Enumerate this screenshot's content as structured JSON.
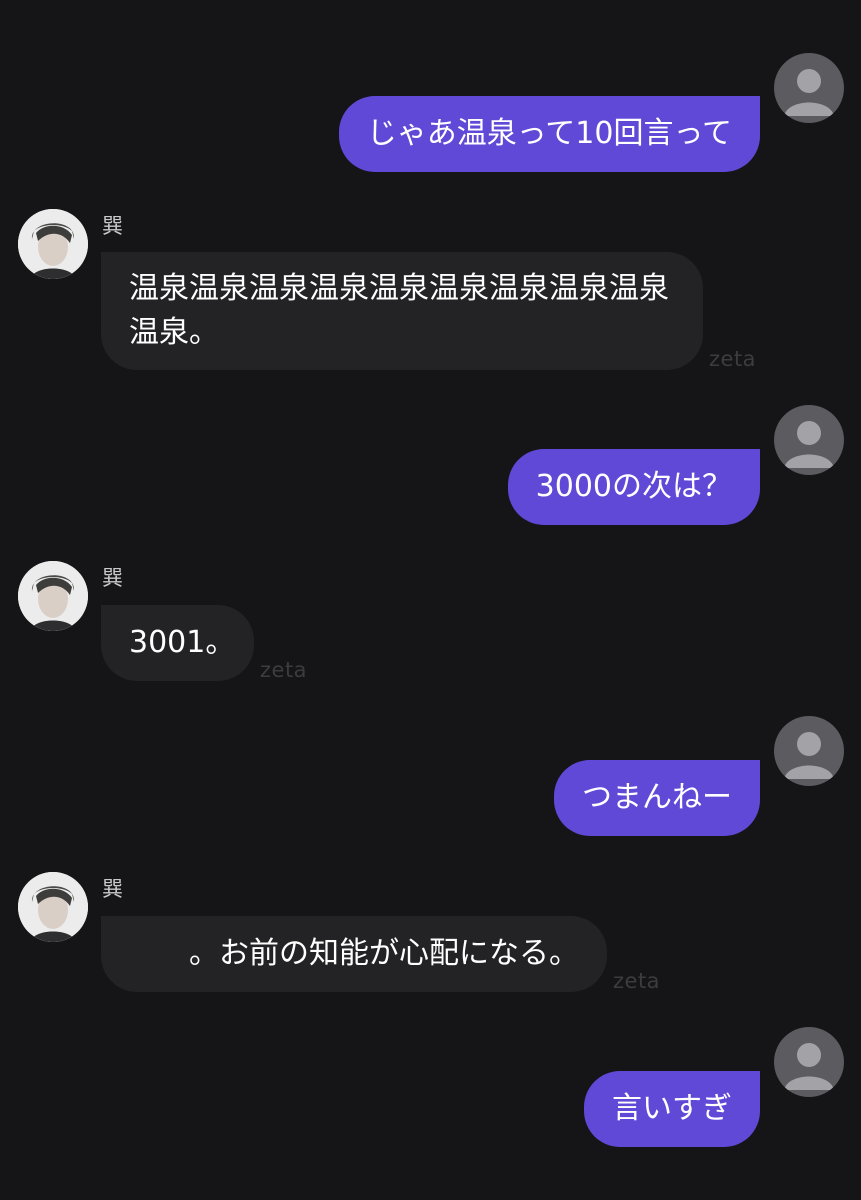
{
  "bot": {
    "name": "巽"
  },
  "watermark": "zeta",
  "messages": [
    {
      "role": "user",
      "text": "じゃあ温泉って10回言って"
    },
    {
      "role": "bot",
      "text": "温泉温泉温泉温泉温泉温泉温泉温泉温泉\n温泉。"
    },
    {
      "role": "user",
      "text": "3000の次は？"
    },
    {
      "role": "bot",
      "text": "3001。"
    },
    {
      "role": "user",
      "text": "つまんねー"
    },
    {
      "role": "bot",
      "text": "。お前の知能が心配になる。"
    },
    {
      "role": "user",
      "text": "言いすぎ"
    }
  ],
  "icons": {
    "user_avatar": "default-user-avatar-icon",
    "bot_avatar": "character-portrait"
  },
  "colors": {
    "background": "#151517",
    "user_bubble": "#6149d8",
    "bot_bubble": "#232325"
  }
}
